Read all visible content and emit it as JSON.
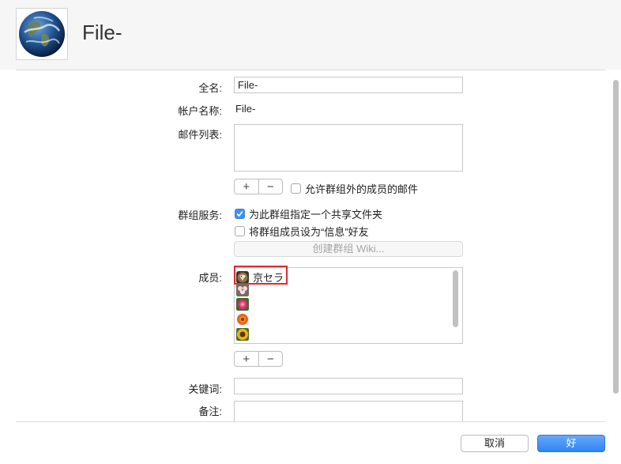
{
  "header": {
    "title": "File-",
    "avatar_icon": "earth-globe-icon"
  },
  "form": {
    "fullname_label": "全名:",
    "fullname_value": "File-",
    "account_label": "帐户名称:",
    "account_value": "File-",
    "mail_label": "邮件列表:",
    "add_symbol": "+",
    "remove_symbol": "−",
    "allow_external_mail": {
      "label": "允许群组外的成员的邮件",
      "checked": false
    },
    "group_services_label": "群组服务:",
    "shared_folder": {
      "label": "为此群组指定一个共享文件夹",
      "checked": true
    },
    "messages_buddies": {
      "label": "将群组成员设为“信息”好友",
      "checked": false
    },
    "create_wiki_label": "创建群组 Wiki...",
    "members_label": "成员:",
    "members": [
      {
        "name": "京セラ",
        "icon": "eagle-avatar-icon",
        "color": "#6b5a3e"
      },
      {
        "name": "",
        "icon": "flower-pink-white-avatar-icon",
        "color": "#d9a5b3"
      },
      {
        "name": "",
        "icon": "flower-magenta-avatar-icon",
        "color": "#e0287d"
      },
      {
        "name": "",
        "icon": "flower-orange-avatar-icon",
        "color": "#e4661c"
      },
      {
        "name": "",
        "icon": "sunflower-avatar-icon",
        "color": "#e9b616"
      }
    ],
    "keywords_label": "关键词:",
    "keywords_value": "",
    "notes_label": "备注:"
  },
  "buttons": {
    "cancel": "取消",
    "ok": "好"
  },
  "colors": {
    "accent": "#3e8ef7",
    "highlight_border": "#e12a2a"
  }
}
